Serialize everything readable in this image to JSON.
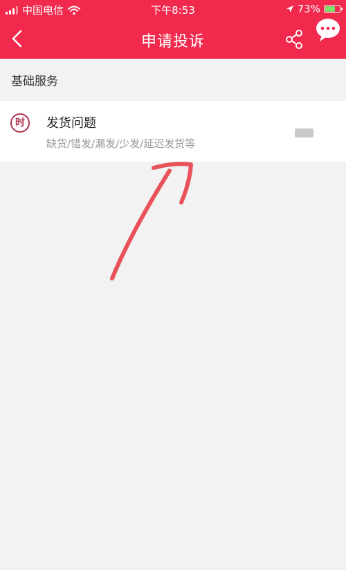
{
  "status_bar": {
    "carrier": "中国电信",
    "time": "下午8:53",
    "battery_percent": "73%",
    "battery_level": 0.73,
    "icons": [
      "signal-icon",
      "wifi-icon",
      "location-icon",
      "battery-icon"
    ]
  },
  "nav": {
    "title": "申请投诉",
    "icons": [
      "back-icon",
      "share-icon",
      "chat-icon"
    ]
  },
  "section": {
    "title": "基础服务"
  },
  "items": [
    {
      "icon_text": "时",
      "title": "发货问题",
      "subtitle": "缺货/错发/漏发/少发/延迟发货等"
    }
  ],
  "colors": {
    "brand": "#f0294d",
    "icon_accent": "#b2324f",
    "annotation": "#e8525a"
  }
}
